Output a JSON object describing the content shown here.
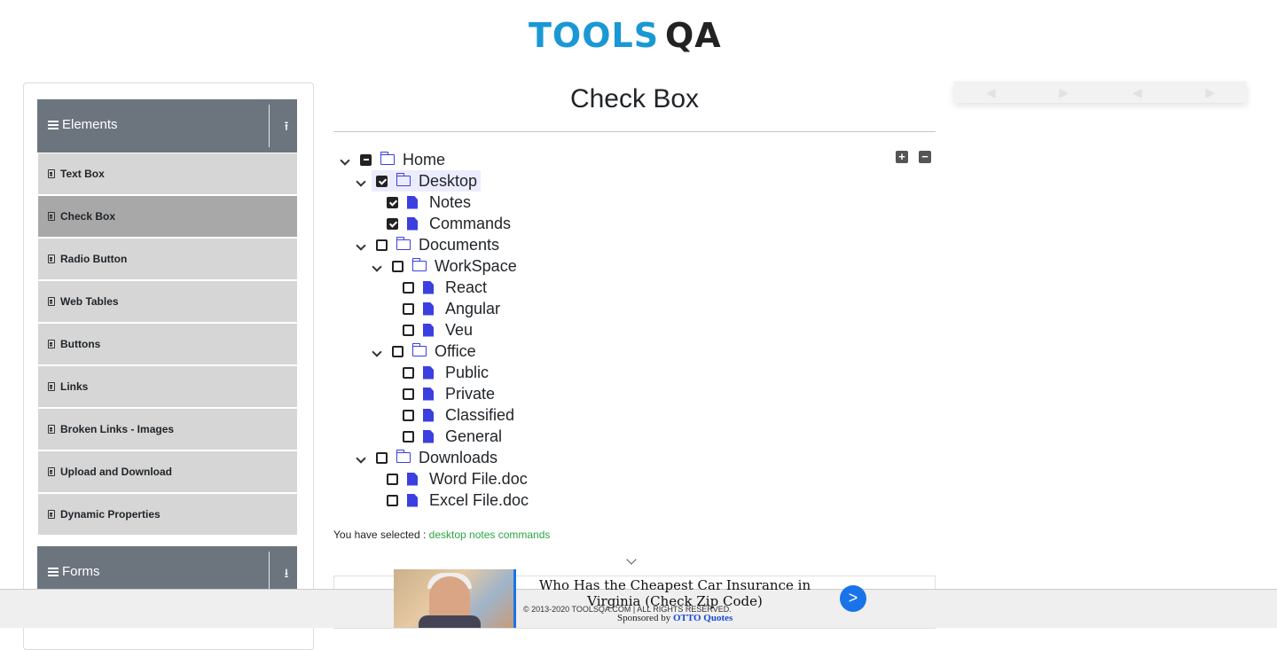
{
  "header": {
    "logo_part1": "TOOLS",
    "logo_part2": "QA"
  },
  "sidebar": {
    "elements_group": {
      "label": "Elements",
      "toggle_icon": "arrow-up-icon"
    },
    "items": [
      {
        "label": "Text Box",
        "active": false
      },
      {
        "label": "Check Box",
        "active": true
      },
      {
        "label": "Radio Button",
        "active": false
      },
      {
        "label": "Web Tables",
        "active": false
      },
      {
        "label": "Buttons",
        "active": false
      },
      {
        "label": "Links",
        "active": false
      },
      {
        "label": "Broken Links - Images",
        "active": false
      },
      {
        "label": "Upload and Download",
        "active": false
      },
      {
        "label": "Dynamic Properties",
        "active": false
      }
    ],
    "forms_group": {
      "label": "Forms",
      "toggle_icon": "arrow-down-icon"
    }
  },
  "main": {
    "title": "Check Box",
    "tree_actions": {
      "expand_all": "+",
      "collapse_all": "−"
    },
    "tree": {
      "home": "Home",
      "desktop": "Desktop",
      "notes": "Notes",
      "commands": "Commands",
      "documents": "Documents",
      "workspace": "WorkSpace",
      "react": "React",
      "angular": "Angular",
      "veu": "Veu",
      "office": "Office",
      "public": "Public",
      "private": "Private",
      "classified": "Classified",
      "general": "General",
      "downloads": "Downloads",
      "word_file": "Word File.doc",
      "excel_file": "Excel File.doc"
    },
    "selected_prefix": "You have selected :",
    "selected_values": "desktop notes commands"
  },
  "footer": {
    "copyright": "© 2013-2020 TOOLSQA.COM | ALL RIGHTS RESERVED."
  },
  "ad": {
    "title": "Who Has the Cheapest Car Insurance in Virginia (Check Zip Code)",
    "sponsored_prefix": "Sponsored by",
    "sponsor": "OTTO Quotes",
    "go_label": ">"
  },
  "colors": {
    "accent_blue": "#1a98d5",
    "group_header": "#6c757d",
    "selected_green": "#28a745",
    "icon_blue": "#3b3fe0"
  }
}
